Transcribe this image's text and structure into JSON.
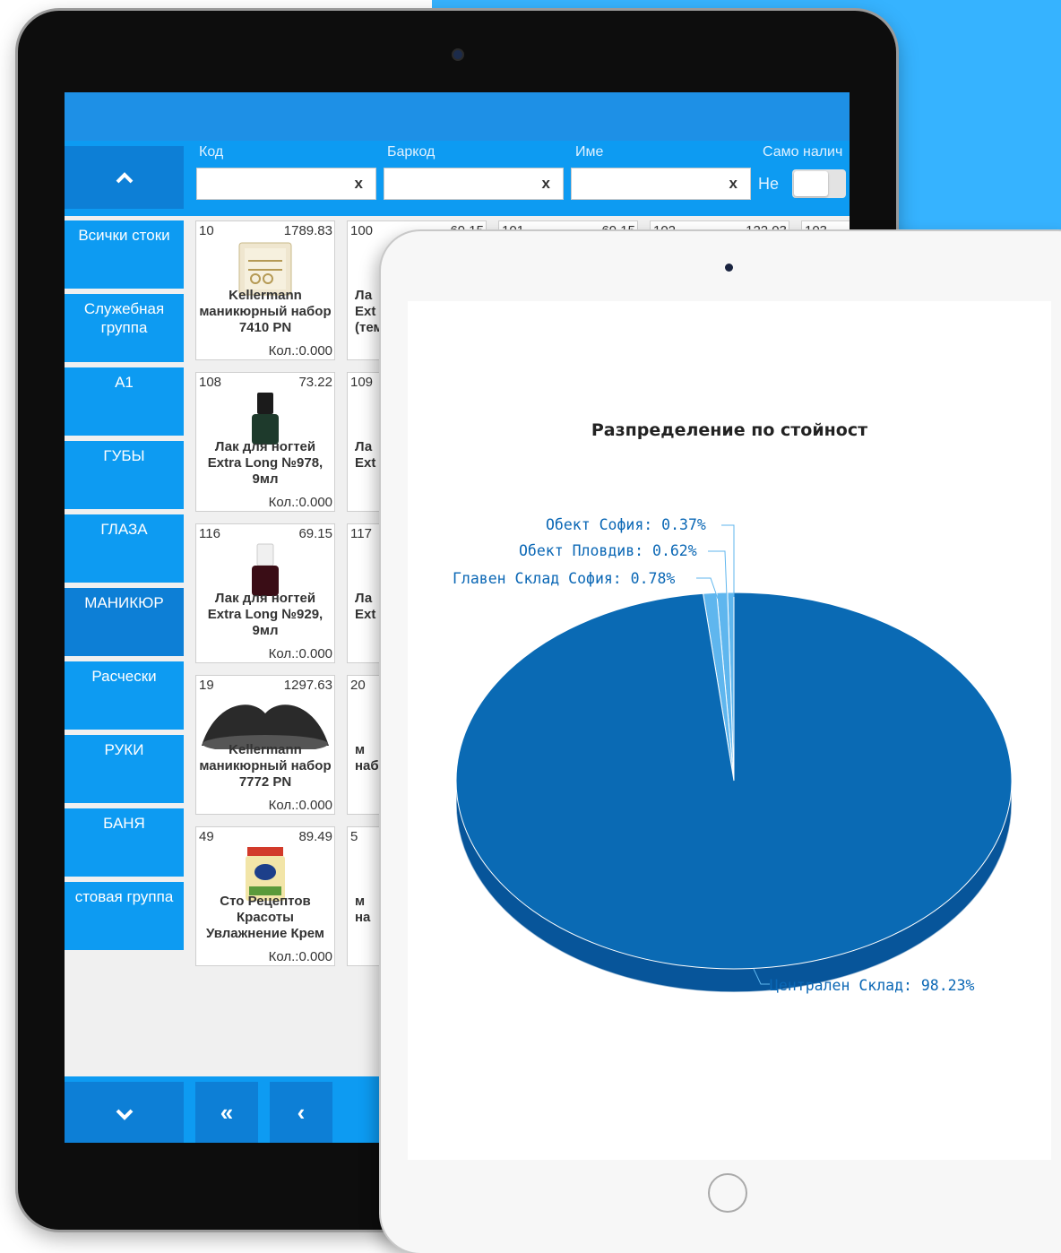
{
  "filters": {
    "code_label": "Код",
    "barcode_label": "Баркод",
    "name_label": "Име",
    "in_stock_label": "Само налич",
    "in_stock_value": "Не",
    "clear_symbol": "x"
  },
  "categories": [
    {
      "label": "Всички стоки"
    },
    {
      "label": "Служебная группа"
    },
    {
      "label": "А1"
    },
    {
      "label": "ГУБЫ"
    },
    {
      "label": "ГЛАЗА"
    },
    {
      "label": "МАНИКЮР"
    },
    {
      "label": "Расчески"
    },
    {
      "label": "РУКИ"
    },
    {
      "label": "БАНЯ"
    },
    {
      "label": "стовая группа"
    }
  ],
  "products": [
    {
      "code": "10",
      "price": "1789.83",
      "name": "Kellermann маникюрный набор 7410 PN",
      "qty": "Кол.:0.000"
    },
    {
      "code": "108",
      "price": "73.22",
      "name": "Лак для ногтей Extra Long №978, 9мл",
      "qty": "Кол.:0.000"
    },
    {
      "code": "116",
      "price": "69.15",
      "name": "Лак для ногтей Extra Long №929, 9мл",
      "qty": "Кол.:0.000"
    },
    {
      "code": "19",
      "price": "1297.63",
      "name": "Kellermann маникюрный набор 7772 PN",
      "qty": "Кол.:0.000"
    },
    {
      "code": "49",
      "price": "89.49",
      "name": "Сто Рецептов Красоты Увлажнение Крем",
      "qty": "Кол.:0.000"
    }
  ],
  "products_col2": [
    {
      "code": "100",
      "name_fragment": "Ла Ext (тем"
    },
    {
      "code": "109",
      "name_fragment": "Ла Ext"
    },
    {
      "code": "117",
      "name_fragment": "Ла Ext"
    },
    {
      "code": "20",
      "name_fragment": "м наб"
    },
    {
      "code": "5",
      "name_fragment": "м на"
    }
  ],
  "products_top_partial": [
    {
      "code": "101",
      "price": "69.15"
    },
    {
      "code": "102",
      "price": "122.03"
    },
    {
      "code": "103",
      "price": ""
    }
  ],
  "products_top_partial_col2_price": "69.15",
  "nav": {
    "first_label": "«",
    "prev_label": "‹"
  },
  "chart_data": {
    "type": "pie",
    "title": "Разпределение по стойност",
    "slices": [
      {
        "label": "Централен Склад",
        "value": 98.23
      },
      {
        "label": "Главен Склад София",
        "value": 0.78
      },
      {
        "label": "Обект Пловдив",
        "value": 0.62
      },
      {
        "label": "Обект София",
        "value": 0.37
      }
    ],
    "labels_text": [
      "Обект София: 0.37%",
      "Обект Пловдив: 0.62%",
      "Главен Склад София: 0.78%",
      "Централен Склад: 98.23%"
    ],
    "colors": {
      "main": "#0a6ab4",
      "side": "#07559a",
      "small_slices": "#5fb6ee",
      "labels": "#0a67b5"
    }
  },
  "colors": {
    "accent": "#36b3ff",
    "bar": "#0d9bf2",
    "active": "#0d7fd6"
  }
}
